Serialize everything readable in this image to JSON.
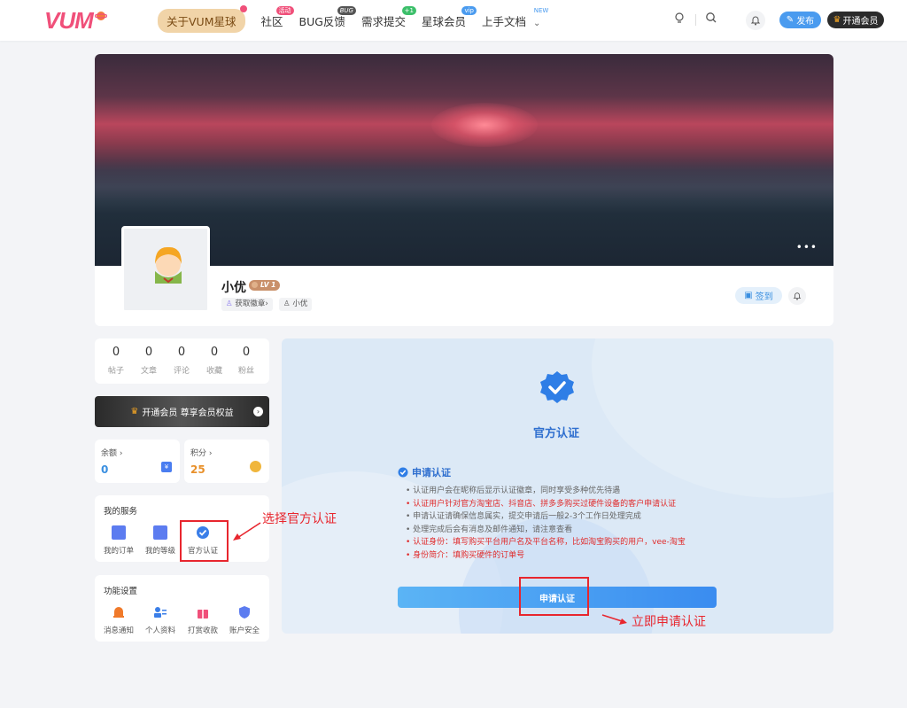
{
  "header": {
    "logo_text": "VUM",
    "nav": [
      {
        "label": "关于VUM星球",
        "badge": ""
      },
      {
        "label": "社区",
        "badge": "活动"
      },
      {
        "label": "BUG反馈",
        "badge": "BUG"
      },
      {
        "label": "需求提交",
        "badge": "+1"
      },
      {
        "label": "星球会员",
        "badge": "vip"
      },
      {
        "label": "上手文档",
        "badge": "NEW"
      }
    ],
    "publish_label": "发布",
    "vip_label": "开通会员"
  },
  "profile": {
    "name": "小优",
    "level": "LV 1",
    "badge_link": "获取徽章",
    "username": "小优",
    "checkin_label": "签到"
  },
  "stats": [
    {
      "value": "0",
      "label": "帖子"
    },
    {
      "value": "0",
      "label": "文章"
    },
    {
      "value": "0",
      "label": "评论"
    },
    {
      "value": "0",
      "label": "收藏"
    },
    {
      "value": "0",
      "label": "粉丝"
    }
  ],
  "vip_banner": {
    "label": "开通会员 尊享会员权益"
  },
  "balance": {
    "label": "余额",
    "value": "0"
  },
  "points": {
    "label": "积分",
    "value": "25"
  },
  "my_services": {
    "title": "我的服务",
    "items": [
      "我的订单",
      "我的等级",
      "官方认证"
    ]
  },
  "settings": {
    "title": "功能设置",
    "items": [
      "消息通知",
      "个人资料",
      "打赏收款",
      "账户安全"
    ]
  },
  "certification": {
    "title": "官方认证",
    "apply_heading": "申请认证",
    "rules": [
      {
        "text": "认证用户会在昵称后显示认证徽章，同时享受多种优先待遇",
        "red": false
      },
      {
        "text": "认证用户针对官方淘宝店、抖音店、拼多多购买过硬件设备的客户申请认证",
        "red": true
      },
      {
        "text": "申请认证请确保信息属实，提交申请后一般2-3个工作日处理完成",
        "red": false
      },
      {
        "text": "处理完成后会有消息及邮件通知，请注意查看",
        "red": false
      },
      {
        "text": "认证身份：填写购买平台用户名及平台名称，比如淘宝购买的用户，vee-淘宝",
        "red": true
      },
      {
        "text": "身份简介：填购买硬件的订单号",
        "red": true
      }
    ],
    "apply_button": "申请认证"
  },
  "annotations": {
    "select_official": "选择官方认证",
    "apply_now": "立即申请认证"
  },
  "colors": {
    "brand_pink": "#f0507a",
    "primary_blue": "#4a9bef",
    "annotation_red": "#e8262e",
    "rule_red": "#e02b2b"
  }
}
